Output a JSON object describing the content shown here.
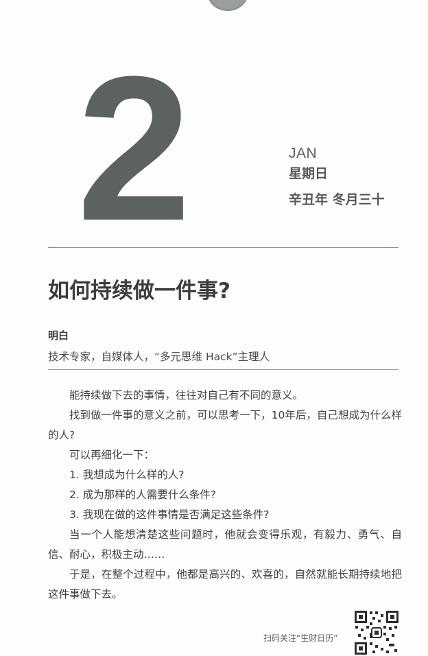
{
  "date": {
    "day": "2",
    "month": "JAN",
    "weekday": "星期日",
    "lunar": "辛丑年  冬月三十"
  },
  "article": {
    "title": "如何持续做一件事?",
    "author_name": "明白",
    "author_desc": "技术专家，自媒体人，“多元思维 Hack”主理人",
    "paragraphs": [
      "能持续做下去的事情，往往对自己有不同的意义。",
      "找到做一件事的意义之前，可以思考一下，10年后，自己想成为什么样的人?",
      "可以再细化一下：",
      "1. 我想成为什么样的人?",
      "2. 成为那样的人需要什么条件?",
      "3. 我现在做的这件事情是否满足这些条件?",
      "当一个人能想清楚这些问题时，他就会变得乐观，有毅力、勇气、自信、耐心，积极主动……",
      "于是，在整个过程中，他都是高兴的、欢喜的，自然就能长期持续地把这件事做下去。"
    ]
  },
  "footer": {
    "qr_caption": "扫码关注“生财日历”"
  }
}
